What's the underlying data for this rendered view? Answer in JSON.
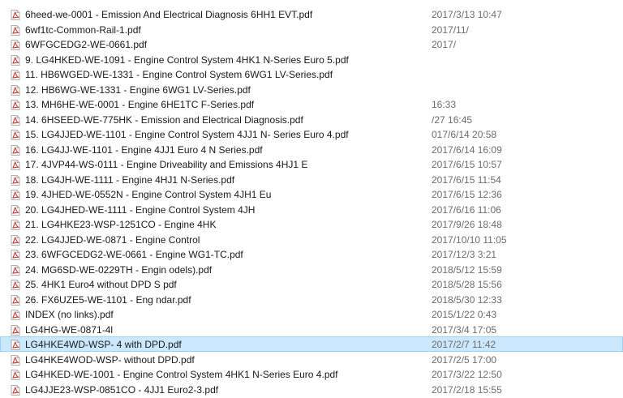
{
  "files": [
    {
      "name": "6heed-we-0001 - Emission And Electrical Diagnosis 6HH1 EVT.pdf",
      "date": "2017/3/13 10:47",
      "icon": "pdf-file-icon"
    },
    {
      "name": "6wf1tc-Common-Rail-1.pdf",
      "date": "2017/11/",
      "icon": "pdf-file-icon"
    },
    {
      "name": "6WFGCEDG2-WE-0661.pdf",
      "date": "2017/",
      "icon": "pdf-file-icon"
    },
    {
      "name": "9. LG4HKED-WE-1091 - Engine Control System 4HK1 N-Series Euro 5.pdf",
      "date": "",
      "icon": "pdf-file-icon"
    },
    {
      "name": "11. HB6WGED-WE-1331 - Engine Control System 6WG1 LV-Series.pdf",
      "date": "",
      "icon": "pdf-file-icon"
    },
    {
      "name": "12. HB6WG-WE-1331 - Engine 6WG1 LV-Series.pdf",
      "date": "",
      "icon": "pdf-file-icon"
    },
    {
      "name": "13. MH6HE-WE-0001 - Engine 6HE1TC F-Series.pdf",
      "date": "16:33",
      "icon": "pdf-file-icon"
    },
    {
      "name": "14. 6HSEED-WE-775HK - Emission and Electrical Diagnosis.pdf",
      "date": "/27 16:45",
      "icon": "pdf-file-icon"
    },
    {
      "name": "15. LG4JJED-WE-1101 - Engine Control System 4JJ1 N- Series Euro 4.pdf",
      "date": "017/6/14 20:58",
      "icon": "pdf-file-icon"
    },
    {
      "name": "16. LG4JJ-WE-1101 - Engine 4JJ1 Euro 4 N Series.pdf",
      "date": "2017/6/14 16:09",
      "icon": "pdf-file-icon"
    },
    {
      "name": "17. 4JVP44-WS-0111 - Engine Driveability and Emissions 4HJ1 E",
      "date": "2017/6/15 10:57",
      "icon": "pdf-file-icon"
    },
    {
      "name": "18. LG4JH-WE-1111 - Engine 4HJ1 N-Series.pdf",
      "date": "2017/6/15 11:54",
      "icon": "pdf-file-icon"
    },
    {
      "name": "19. 4JHED-WE-0552N - Engine Control System 4JH1 Eu",
      "date": "2017/6/15 12:36",
      "icon": "pdf-file-icon"
    },
    {
      "name": "20. LG4JHED-WE-1111 - Engine Control System 4JH",
      "date": "2017/6/16 11:06",
      "icon": "pdf-file-icon"
    },
    {
      "name": "21. LG4HKE23-WSP-1251CO - Engine  4HK",
      "date": "2017/9/26 18:48",
      "icon": "pdf-file-icon"
    },
    {
      "name": "22. LG4JJED-WE-0871 - Engine Control",
      "date": "2017/10/10 11:05",
      "icon": "pdf-file-icon"
    },
    {
      "name": "23. 6WFGCEDG2-WE-0661 - Engine                            WG1-TC.pdf",
      "date": "2017/12/3 3:21",
      "icon": "pdf-file-icon"
    },
    {
      "name": "24. MG6SD-WE-0229TH - Engin                    odels).pdf",
      "date": "2018/5/12 15:59",
      "icon": "pdf-file-icon"
    },
    {
      "name": "25. 4HK1 Euro4 without DPD S                    pdf",
      "date": "2018/5/28 15:56",
      "icon": "pdf-file-icon"
    },
    {
      "name": "26. FX6UZE5-WE-1101 - Eng                     ndar.pdf",
      "date": "2018/5/30 12:33",
      "icon": "pdf-file-icon"
    },
    {
      "name": "INDEX (no links).pdf",
      "date": "2015/1/22 0:43",
      "icon": "pdf-file-icon"
    },
    {
      "name": "LG4HG-WE-0871-4l",
      "date": "2017/3/4 17:05",
      "icon": "pdf-file-icon"
    },
    {
      "name": "LG4HKE4WD-WSP-                   4 with DPD.pdf",
      "date": "2017/2/7 11:42",
      "icon": "pdf-file-icon",
      "selected": true
    },
    {
      "name": "LG4HKE4WOD-WSP-              without DPD.pdf",
      "date": "2017/2/5 17:00",
      "icon": "pdf-file-icon"
    },
    {
      "name": "LG4HKED-WE-1001 - Engine Control System 4HK1 N-Series Euro 4.pdf",
      "date": "2017/3/22 12:50",
      "icon": "pdf-file-icon"
    },
    {
      "name": "LG4JJE23-WSP-0851CO - 4JJ1 Euro2-3.pdf",
      "date": "2017/2/18 15:55",
      "icon": "pdf-file-icon"
    }
  ],
  "colors": {
    "selection_bg": "#cce8ff",
    "selection_border": "#99d1ff",
    "pdf_red": "#d9352c"
  }
}
